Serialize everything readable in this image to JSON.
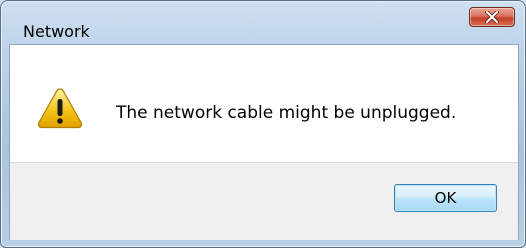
{
  "window": {
    "title": "Network"
  },
  "dialog": {
    "icon": "warning-icon",
    "message": "The network cable might be unplugged.",
    "ok_label": "OK"
  },
  "colors": {
    "close_button": "#c94a35",
    "warning_yellow": "#f5c417",
    "ok_button_border": "#3c7fb1"
  }
}
